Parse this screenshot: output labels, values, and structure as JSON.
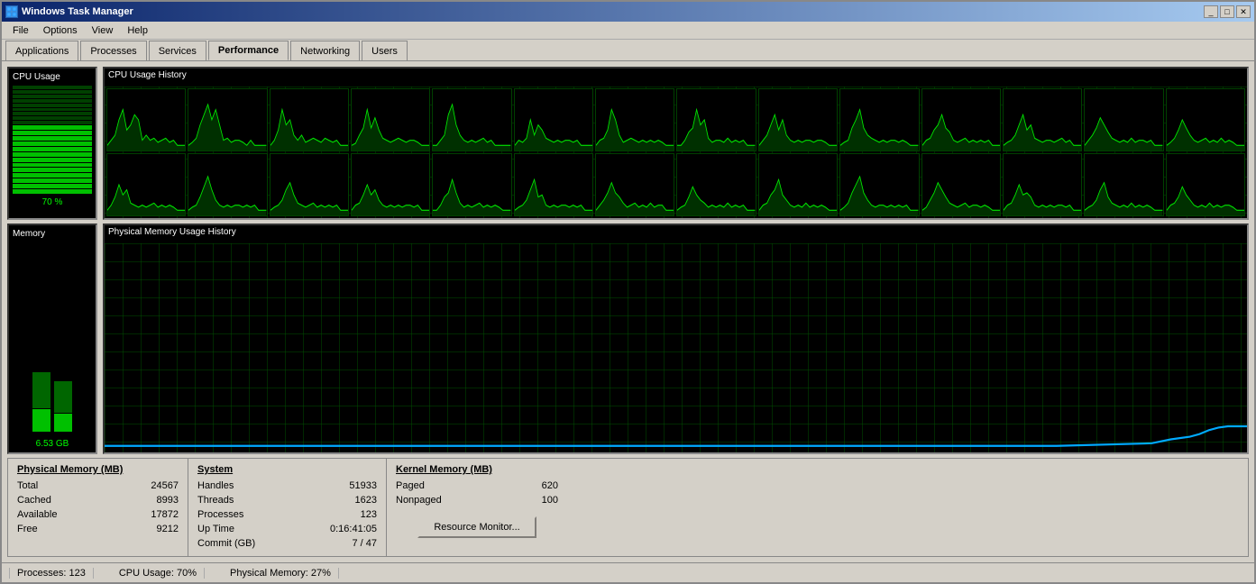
{
  "window": {
    "title": "Windows Task Manager",
    "icon": "⊞"
  },
  "title_buttons": {
    "minimize": "_",
    "maximize": "□",
    "close": "✕"
  },
  "menu": {
    "items": [
      "File",
      "Options",
      "View",
      "Help"
    ]
  },
  "tabs": {
    "items": [
      "Applications",
      "Processes",
      "Services",
      "Performance",
      "Networking",
      "Users"
    ],
    "active": "Performance"
  },
  "cpu_gauge": {
    "label": "CPU Usage",
    "value": "70 %"
  },
  "cpu_history": {
    "label": "CPU Usage History"
  },
  "memory_gauge": {
    "label": "Memory",
    "value": "6.53 GB"
  },
  "memory_history": {
    "label": "Physical Memory Usage History"
  },
  "physical_memory": {
    "header": "Physical Memory (MB)",
    "rows": [
      {
        "label": "Total",
        "value": "24567"
      },
      {
        "label": "Cached",
        "value": "8993"
      },
      {
        "label": "Available",
        "value": "17872"
      },
      {
        "label": "Free",
        "value": "9212"
      }
    ]
  },
  "system": {
    "header": "System",
    "rows": [
      {
        "label": "Handles",
        "value": "51933"
      },
      {
        "label": "Threads",
        "value": "1623"
      },
      {
        "label": "Processes",
        "value": "123"
      },
      {
        "label": "Up Time",
        "value": "0:16:41:05"
      },
      {
        "label": "Commit (GB)",
        "value": "7 / 47"
      }
    ]
  },
  "kernel_memory": {
    "header": "Kernel Memory (MB)",
    "rows": [
      {
        "label": "Paged",
        "value": "620"
      },
      {
        "label": "Nonpaged",
        "value": "100"
      }
    ]
  },
  "resource_monitor_btn": "Resource Monitor...",
  "status_bar": {
    "processes": "Processes: 123",
    "cpu_usage": "CPU Usage: 70%",
    "physical_memory": "Physical Memory: 27%"
  }
}
